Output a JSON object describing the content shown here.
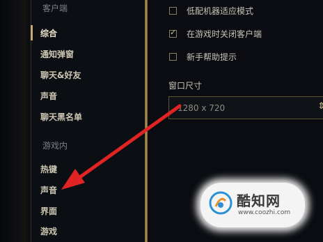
{
  "sidebar": {
    "client_section": "客户端",
    "client_items": [
      "综合",
      "通知弹窗",
      "聊天&好友",
      "声音",
      "聊天黑名单"
    ],
    "ingame_section": "游戏内",
    "ingame_items": [
      "热键",
      "声音",
      "界面",
      "游戏"
    ]
  },
  "settings": {
    "options": [
      {
        "label": "低配机器适应模式",
        "checked": false
      },
      {
        "label": "在游戏时关闭客户端",
        "checked": true
      },
      {
        "label": "新手帮助提示",
        "checked": false
      }
    ],
    "window_size_label": "窗口尺寸",
    "window_size_value": "1280 x 720"
  },
  "watermark": {
    "title": "酷知网",
    "url": "www.coozhi.com"
  },
  "colors": {
    "accent": "#c8aa6e",
    "arrow": "#e02424"
  },
  "icons": {
    "checkbox_checked": "check-icon",
    "select_arrow": "chevron-up-down-icon",
    "watermark_logo": "coozhi-logo"
  }
}
